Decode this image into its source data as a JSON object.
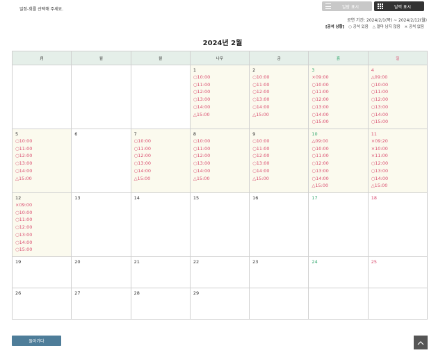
{
  "instruction": "일정-회를 선택해 주세요.",
  "view_toggle": {
    "list_label": "일람 표시",
    "calendar_label": "달력 표시",
    "list_icon": "list-icon",
    "calendar_icon": "grid-icon"
  },
  "period": "공연 기간: 2024/2/1(목) ~ 2024/2/12(월)",
  "legend": {
    "title": "[공석 상황]",
    "items": [
      "○ 공석 있음",
      "△ 얼마 남지 않음",
      "× 공석 없음"
    ]
  },
  "month_title": "2024년 2월",
  "weekdays": [
    "月",
    "월",
    "월",
    "나무",
    "금",
    "흙",
    "일"
  ],
  "colors": {
    "header_bg": "#e5efe9",
    "performance_day_bg": "#fbfaee",
    "slot_text": "#d94c6e",
    "saturday": "#2fa66b",
    "sunday": "#d94c6e",
    "back_button": "#4e7d99",
    "top_button": "#555555"
  },
  "weeks": [
    [
      {
        "day": "",
        "slots": []
      },
      {
        "day": "",
        "slots": []
      },
      {
        "day": "",
        "slots": []
      },
      {
        "day": "1",
        "slots": [
          "○10:00",
          "○11:00",
          "○12:00",
          "○13:00",
          "○14:00",
          "△15:00"
        ]
      },
      {
        "day": "2",
        "slots": [
          "○10:00",
          "○11:00",
          "○12:00",
          "○13:00",
          "○14:00",
          "△15:00"
        ]
      },
      {
        "day": "3",
        "slots": [
          "×09:00",
          "○10:00",
          "○11:00",
          "○12:00",
          "○13:00",
          "○14:00",
          "○15:00"
        ]
      },
      {
        "day": "4",
        "slots": [
          "△09:00",
          "○10:00",
          "○11:00",
          "○12:00",
          "○13:00",
          "○14:00",
          "○15:00"
        ]
      }
    ],
    [
      {
        "day": "5",
        "slots": [
          "○10:00",
          "○11:00",
          "○12:00",
          "○13:00",
          "○14:00",
          "△15:00"
        ]
      },
      {
        "day": "6",
        "slots": []
      },
      {
        "day": "7",
        "slots": [
          "○10:00",
          "○11:00",
          "○12:00",
          "○13:00",
          "○14:00",
          "△15:00"
        ]
      },
      {
        "day": "8",
        "slots": [
          "○10:00",
          "○11:00",
          "○12:00",
          "○13:00",
          "○14:00",
          "△15:00"
        ]
      },
      {
        "day": "9",
        "slots": [
          "○10:00",
          "○11:00",
          "○12:00",
          "○13:00",
          "○14:00",
          "△15:00"
        ]
      },
      {
        "day": "10",
        "slots": [
          "△09:00",
          "○10:00",
          "○11:00",
          "○12:00",
          "○13:00",
          "○14:00",
          "△15:00"
        ]
      },
      {
        "day": "11",
        "slots": [
          "×09:20",
          "×10:00",
          "×11:00",
          "○12:00",
          "○13:00",
          "○14:00",
          "△15:00"
        ]
      }
    ],
    [
      {
        "day": "12",
        "slots": [
          "×09:00",
          "○10:00",
          "○11:00",
          "○12:00",
          "○13:00",
          "○14:00",
          "○15:00"
        ]
      },
      {
        "day": "13",
        "slots": []
      },
      {
        "day": "14",
        "slots": []
      },
      {
        "day": "15",
        "slots": []
      },
      {
        "day": "16",
        "slots": []
      },
      {
        "day": "17",
        "slots": []
      },
      {
        "day": "18",
        "slots": []
      }
    ],
    [
      {
        "day": "19",
        "slots": []
      },
      {
        "day": "20",
        "slots": []
      },
      {
        "day": "21",
        "slots": []
      },
      {
        "day": "22",
        "slots": []
      },
      {
        "day": "23",
        "slots": []
      },
      {
        "day": "24",
        "slots": []
      },
      {
        "day": "25",
        "slots": []
      }
    ],
    [
      {
        "day": "26",
        "slots": []
      },
      {
        "day": "27",
        "slots": []
      },
      {
        "day": "28",
        "slots": []
      },
      {
        "day": "29",
        "slots": []
      },
      {
        "day": "",
        "slots": []
      },
      {
        "day": "",
        "slots": []
      },
      {
        "day": "",
        "slots": []
      }
    ]
  ],
  "back_button": "돌아가다",
  "top_button_icon": "arrow-up-icon"
}
